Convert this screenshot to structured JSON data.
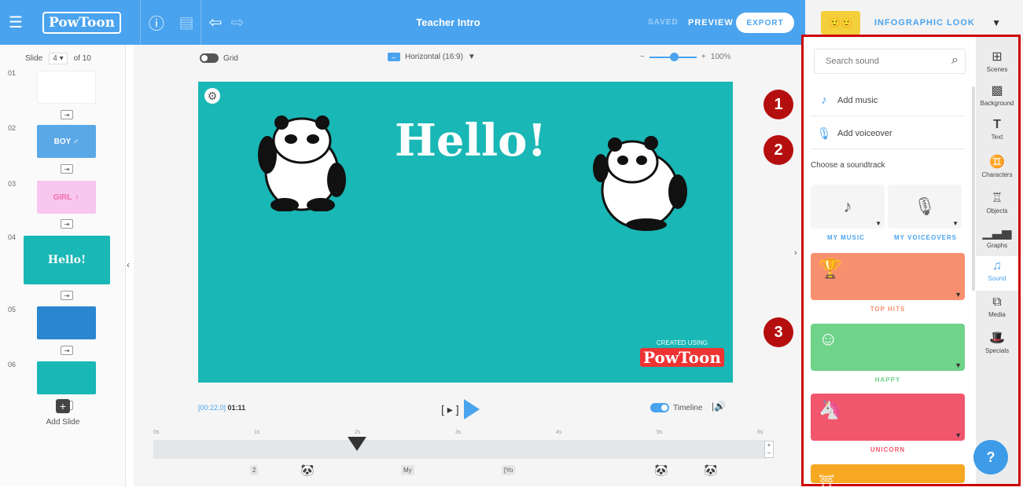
{
  "topbar": {
    "logo": "PowToon",
    "title": "Teacher Intro",
    "saved": "SAVED",
    "preview": "PREVIEW",
    "export": "EXPORT",
    "look": "INFOGRAPHIC LOOK"
  },
  "slides": {
    "label": "Slide",
    "current": "4 ▾",
    "of": "of 10",
    "items": [
      {
        "num": "01",
        "text": "",
        "color": "#ffffff"
      },
      {
        "num": "02",
        "text": "BOY ♂",
        "color": "#5aa8e6"
      },
      {
        "num": "03",
        "text": "GIRL ♀",
        "color": "#f7c7ef"
      },
      {
        "num": "04",
        "text": "Hello!",
        "color": "#19b7b5"
      },
      {
        "num": "05",
        "text": "",
        "color": "#2a86cf"
      },
      {
        "num": "06",
        "text": "",
        "color": "#19b7b5"
      }
    ],
    "add": "Add Slide"
  },
  "canvas": {
    "grid": "Grid",
    "orientation": "Horizontal (16:9)",
    "zoom": "100%",
    "hello": "Hello!",
    "created_using": "CREATED USING",
    "created_logo": "PowToon",
    "time_current": "[00:22.0]",
    "time_total": "01:11",
    "play_bracket": "[ ▸ ]",
    "timeline_label": "Timeline",
    "ruler": [
      "0s",
      "1s",
      "2s",
      "3s",
      "4s",
      "5s",
      "6s"
    ],
    "track_items": [
      "2",
      "My",
      "[Yo"
    ]
  },
  "sound": {
    "search_placeholder": "Search sound",
    "add_music": "Add music",
    "add_voiceover": "Add voiceover",
    "choose": "Choose a soundtrack",
    "my_music": "MY MUSIC",
    "my_voiceovers": "MY VOICEOVERS",
    "genres": [
      {
        "label": "TOP HITS",
        "color": "#f8906f"
      },
      {
        "label": "HAPPY",
        "color": "#6fd38a"
      },
      {
        "label": "UNICORN",
        "color": "#f2566d"
      },
      {
        "label": "",
        "color": "#f7a823"
      }
    ],
    "badges": [
      "1",
      "2",
      "3"
    ]
  },
  "tabs": [
    "Scenes",
    "Background",
    "Text",
    "Characters",
    "Objects",
    "Graphs",
    "Sound",
    "Media",
    "Specials"
  ],
  "help": "?"
}
